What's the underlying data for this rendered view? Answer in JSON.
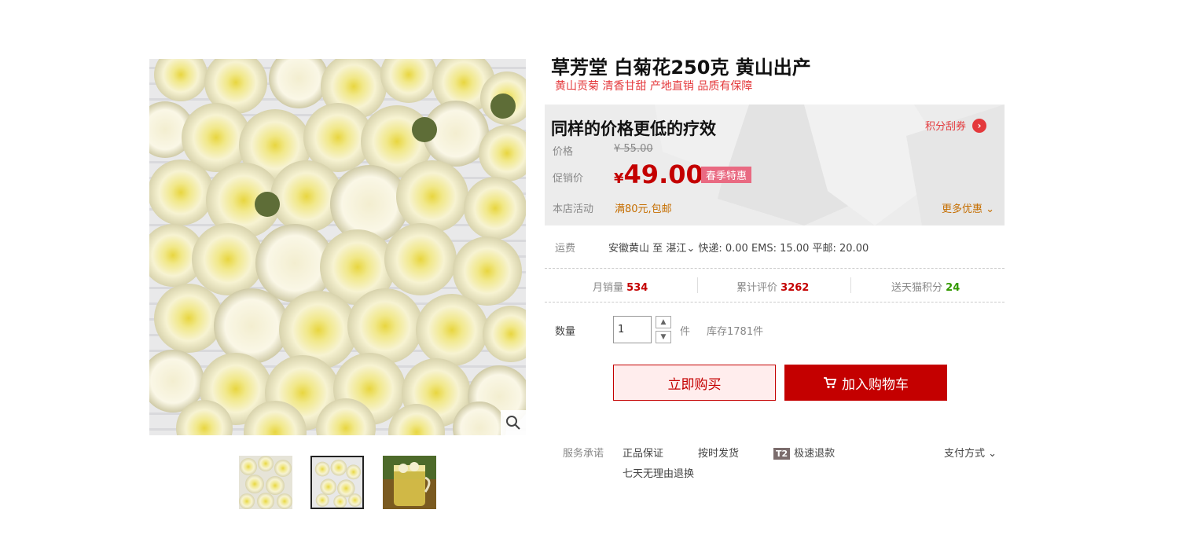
{
  "product": {
    "title": "草芳堂  白菊花250克  黄山出产",
    "subtitle": "黄山贡菊 清香甘甜 产地直销 品质有保障"
  },
  "price_panel": {
    "slogan": "同样的价格更低的疗效",
    "coupon_label": "积分刮券",
    "price_label": "价格",
    "original_price": "¥ 55.00",
    "promo_label": "促销价",
    "currency": "¥",
    "promo_price": "49.00",
    "season_tag": "春季特惠",
    "activity_label": "本店活动",
    "activity_text": "满80元,包邮",
    "more_label": "更多优惠"
  },
  "shipping": {
    "label": "运费",
    "origin": "安徽黄山",
    "to": "至",
    "destination": "湛江",
    "fees": "快递: 0.00 EMS: 15.00 平邮: 20.00"
  },
  "stats": {
    "monthly_sales_label": "月销量",
    "monthly_sales": "534",
    "reviews_label": "累计评价",
    "reviews": "3262",
    "points_label": "送天猫积分",
    "points": "24"
  },
  "purchase": {
    "quantity_label": "数量",
    "quantity": "1",
    "unit": "件",
    "stock": "库存1781件",
    "buy_now": "立即购买",
    "add_to_cart": "加入购物车"
  },
  "services": {
    "label": "服务承诺",
    "items": [
      "正品保证",
      "按时发货",
      "极速退款",
      "七天无理由退换"
    ],
    "t2_badge": "T2",
    "payment": "支付方式"
  },
  "colors": {
    "accent_red": "#c40000",
    "promo_red": "#e4393c",
    "activity_orange": "#c56e00",
    "points_green": "#339900"
  },
  "icons": {
    "zoom": "magnifier-icon",
    "cart": "cart-icon",
    "coupon_arrow": "chevron-right-icon"
  }
}
